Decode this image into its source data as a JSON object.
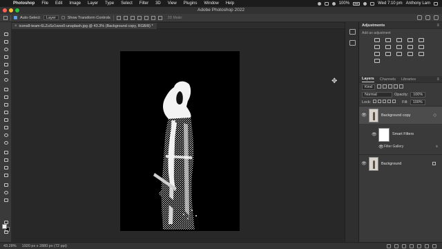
{
  "menubar": {
    "apple": "",
    "items": [
      "Photoshop",
      "File",
      "Edit",
      "Image",
      "Layer",
      "Type",
      "Select",
      "Filter",
      "3D",
      "View",
      "Plugins",
      "Window",
      "Help"
    ],
    "battery": "100%",
    "clock": "Wed 7:10 pm",
    "user": "Anthony Lam"
  },
  "window": {
    "title": "Adobe Photoshop 2022"
  },
  "options": {
    "auto_select_label": "Auto-Select:",
    "auto_select_value": "Layer",
    "transform_label": "Show Transform Controls",
    "mode_3d": "3D Mode:"
  },
  "document": {
    "tab_close": "×",
    "tab_name": "icons8-team-6LZuSz1wxo0-unsplash.jpg @ 43.3% (Background copy, RGB/8) *"
  },
  "status": {
    "zoom": "43.28%",
    "size": "1920 px x 2880 px (72 ppi)"
  },
  "adjustments": {
    "title": "Adjustments",
    "subtitle": "Add an adjustment",
    "menu": "≡"
  },
  "layers_panel": {
    "tabs": [
      "Layers",
      "Channels",
      "Libraries"
    ],
    "menu": "≡",
    "kind": "Kind",
    "blend": "Normal",
    "opacity_label": "Opacity:",
    "opacity_value": "100%",
    "lock_label": "Lock:",
    "fill_label": "Fill:",
    "fill_value": "100%",
    "eye": "👁",
    "layers": [
      {
        "name": "Background copy",
        "selected": true
      },
      {
        "name": "Smart Filters"
      },
      {
        "name": "Filter Gallery"
      },
      {
        "name": "Background"
      }
    ]
  },
  "colors": {
    "accent": "#5a9ee8",
    "panel": "#3a3a3a",
    "canvas": "#282828"
  }
}
